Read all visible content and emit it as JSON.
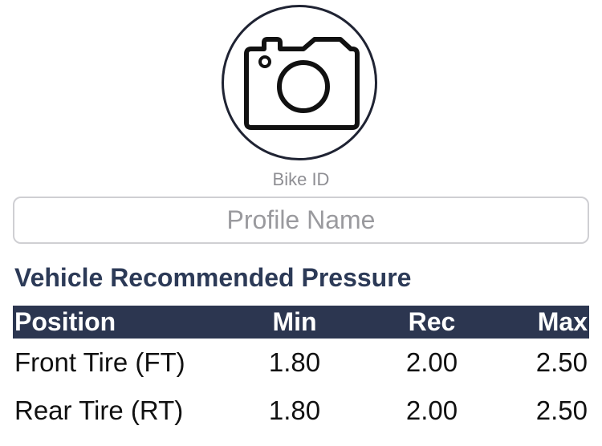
{
  "profile": {
    "photo_icon": "camera-icon",
    "bike_id_label": "Bike ID",
    "name_placeholder": "Profile Name",
    "name_value": ""
  },
  "pressure": {
    "title": "Vehicle Recommended Pressure",
    "columns": [
      "Position",
      "Min",
      "Rec",
      "Max"
    ],
    "rows": [
      [
        "Front Tire (FT)",
        "1.80",
        "2.00",
        "2.50"
      ],
      [
        "Rear Tire (RT)",
        "1.80",
        "2.00",
        "2.50"
      ]
    ]
  },
  "colors": {
    "header_bg": "#2c3650",
    "title_text": "#2c3a57",
    "circle_border": "#1f2333"
  }
}
